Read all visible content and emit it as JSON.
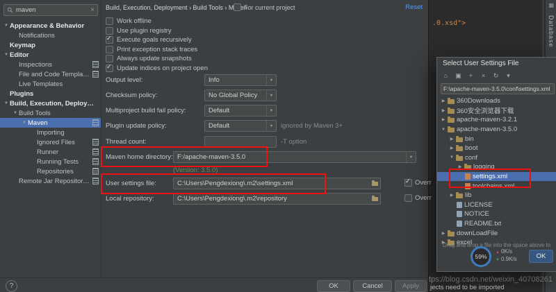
{
  "sidebar": {
    "search_value": "maven",
    "items": [
      {
        "label": "Appearance & Behavior",
        "level": 0,
        "bold": true,
        "arrow": "down"
      },
      {
        "label": "Notifications",
        "level": 1
      },
      {
        "label": "Keymap",
        "level": 0,
        "bold": true
      },
      {
        "label": "Editor",
        "level": 0,
        "bold": true,
        "arrow": "down"
      },
      {
        "label": "Inspections",
        "level": 1,
        "flag": true
      },
      {
        "label": "File and Code Templates",
        "level": 1,
        "flag": true
      },
      {
        "label": "Live Templates",
        "level": 1
      },
      {
        "label": "Plugins",
        "level": 0,
        "bold": true
      },
      {
        "label": "Build, Execution, Deployment",
        "level": 0,
        "bold": true,
        "arrow": "down"
      },
      {
        "label": "Build Tools",
        "level": 1,
        "arrow": "down"
      },
      {
        "label": "Maven",
        "level": 2,
        "arrow": "down",
        "selected": true,
        "flag": true
      },
      {
        "label": "Importing",
        "level": 3
      },
      {
        "label": "Ignored Files",
        "level": 3,
        "flag": true
      },
      {
        "label": "Runner",
        "level": 3,
        "flag": true
      },
      {
        "label": "Running Tests",
        "level": 3,
        "flag": true
      },
      {
        "label": "Repositories",
        "level": 3,
        "flag": true
      },
      {
        "label": "Remote Jar Repositories",
        "level": 1,
        "flag": true
      }
    ]
  },
  "settings": {
    "breadcrumb": "Build, Execution, Deployment › Build Tools › Maven",
    "for_current_project": "For current project",
    "reset_label": "Reset",
    "checkboxes": [
      {
        "label": "Work offline",
        "checked": false
      },
      {
        "label": "Use plugin registry",
        "checked": false
      },
      {
        "label": "Execute goals recursively",
        "checked": true
      },
      {
        "label": "Print exception stack traces",
        "checked": false
      },
      {
        "label": "Always update snapshots",
        "checked": false
      },
      {
        "label": "Update indices on project open",
        "checked": true
      }
    ],
    "fields": {
      "output_level": {
        "label": "Output level:",
        "value": "Info"
      },
      "checksum_policy": {
        "label": "Checksum policy:",
        "value": "No Global Policy"
      },
      "multiproject_fail": {
        "label": "Multiproject build fail policy:",
        "value": "Default"
      },
      "plugin_update": {
        "label": "Plugin update policy:",
        "value": "Default",
        "note": "ignored by Maven 3+"
      },
      "thread_count": {
        "label": "Thread count:",
        "value": "",
        "note": "-T option"
      },
      "maven_home": {
        "label": "Maven home directory:",
        "value": "F:/apache-maven-3.5.0",
        "version_note": "(Version: 3.5.0)"
      },
      "user_settings": {
        "label": "User settings file:",
        "value": "C:\\Users\\Pengdexiong\\.m2\\settings.xml",
        "override_label": "Overr",
        "override_checked": true
      },
      "local_repository": {
        "label": "Local repository:",
        "value": "C:\\Users\\Pengdexiong\\.m2\\repository",
        "override_label": "Overr",
        "override_checked": false
      }
    },
    "buttons": {
      "help": "?",
      "ok": "OK",
      "cancel": "Cancel",
      "apply": "Apply"
    }
  },
  "file_dialog": {
    "title": "Select User Settings File",
    "toolbar_icons": [
      {
        "name": "home-icon",
        "glyph": "⌂"
      },
      {
        "name": "desktop-icon",
        "glyph": "▣"
      },
      {
        "name": "new-folder-icon",
        "glyph": "+"
      },
      {
        "name": "delete-icon",
        "glyph": "×"
      },
      {
        "name": "refresh-icon",
        "glyph": "↻"
      },
      {
        "name": "collapse-all-icon",
        "glyph": "▾"
      }
    ],
    "path": "F:\\apache-maven-3.5.0\\conf\\settings.xml",
    "tree": [
      {
        "label": "360Downloads",
        "type": "folder",
        "level": 0,
        "arrow": "right"
      },
      {
        "label": "360安全浏览器下载",
        "type": "folder",
        "level": 0,
        "arrow": "right"
      },
      {
        "label": "apache-maven-3.2.1",
        "type": "folder",
        "level": 0,
        "arrow": "right"
      },
      {
        "label": "apache-maven-3.5.0",
        "type": "folder",
        "level": 0,
        "arrow": "down"
      },
      {
        "label": "bin",
        "type": "folder",
        "level": 1,
        "arrow": "right"
      },
      {
        "label": "boot",
        "type": "folder",
        "level": 1,
        "arrow": "right"
      },
      {
        "label": "conf",
        "type": "folder",
        "level": 1,
        "arrow": "down"
      },
      {
        "label": "logging",
        "type": "folder",
        "level": 2,
        "arrow": "right"
      },
      {
        "label": "settings.xml",
        "type": "xml",
        "level": 2,
        "selected": true
      },
      {
        "label": "toolchains.xml",
        "type": "xml",
        "level": 2
      },
      {
        "label": "lib",
        "type": "folder",
        "level": 1,
        "arrow": "right"
      },
      {
        "label": "LICENSE",
        "type": "file",
        "level": 1
      },
      {
        "label": "NOTICE",
        "type": "file",
        "level": 1
      },
      {
        "label": "README.txt",
        "type": "file",
        "level": 1
      },
      {
        "label": "downLoadFile",
        "type": "folder",
        "level": 0,
        "arrow": "right"
      },
      {
        "label": "excel",
        "type": "folder",
        "level": 0,
        "arrow": "right"
      }
    ],
    "hint": "Drag and drop a file into the space above to quickly locate",
    "status": {
      "memory": "59%",
      "up": "0K/s",
      "down": "0.9K/s"
    },
    "ok_label": "OK"
  },
  "editor": {
    "code": ".0.xsd\">",
    "database_label": "Database",
    "maven_label": "m"
  },
  "footer": {
    "watermark": "https://blog.csdn.net/weixin_40708261",
    "notification": "jects need to be imported"
  },
  "colors": {
    "accent_selection": "#4b6eaf",
    "annotation": "#ee1111",
    "link": "#589df6",
    "ok_button": "#365880"
  }
}
